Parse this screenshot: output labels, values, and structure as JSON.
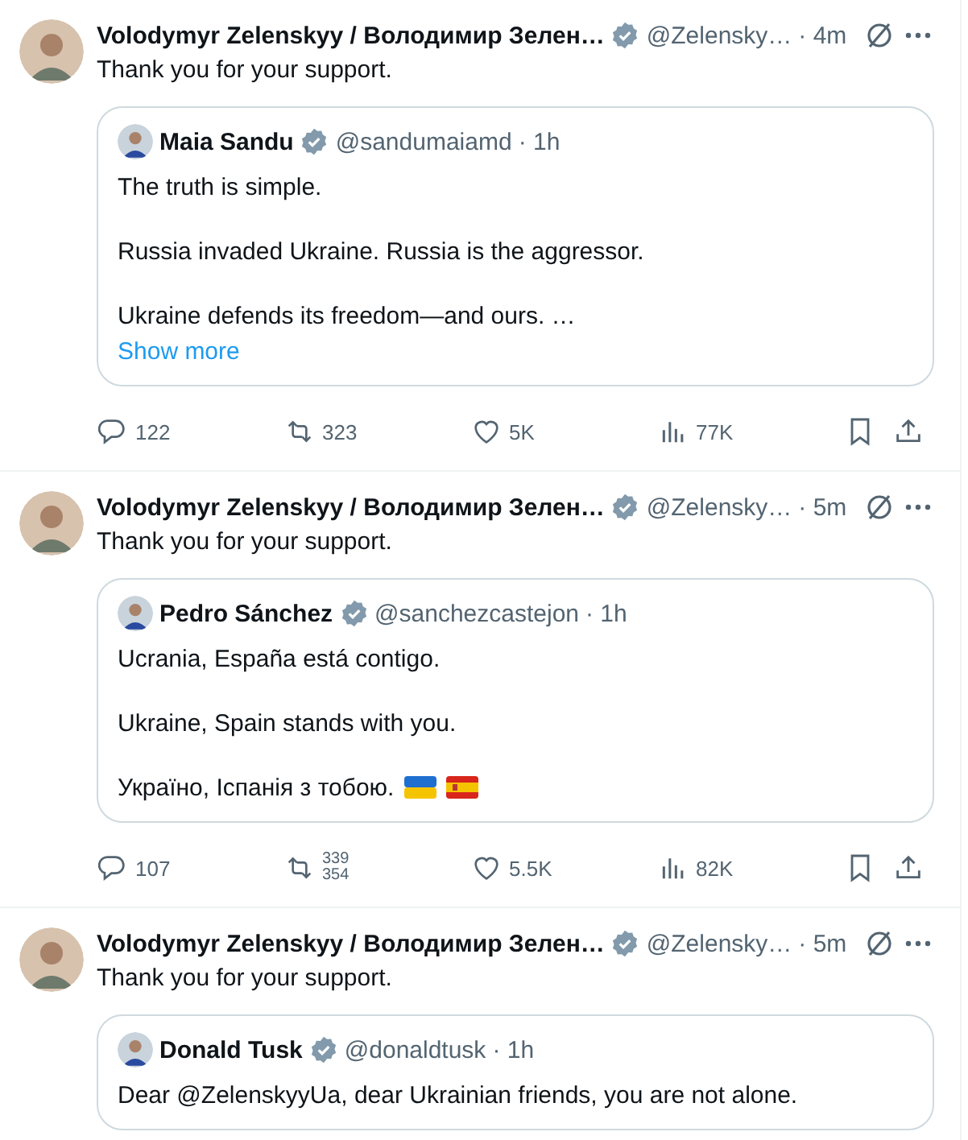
{
  "posts": [
    {
      "author": "Volodymyr Zelenskyy / Володимир Зелен…",
      "handle": "@Zelensky…",
      "time": "· 4m",
      "text": "Thank you for your support.",
      "quote": {
        "author": "Maia Sandu",
        "handle": "@sandumaiamd",
        "time": "· 1h",
        "paragraphs": [
          "The truth is simple.",
          "Russia invaded Ukraine. Russia is the aggressor.",
          "Ukraine defends its freedom—and ours. …"
        ],
        "show_more": "Show more"
      },
      "stats": [
        {
          "kind": "reply",
          "counts": [
            "122"
          ]
        },
        {
          "kind": "repost",
          "counts": [
            "323"
          ]
        },
        {
          "kind": "like",
          "counts": [
            "5K"
          ]
        },
        {
          "kind": "views",
          "counts": [
            "77K"
          ]
        },
        {
          "kind": "bookmark"
        },
        {
          "kind": "share"
        }
      ]
    },
    {
      "author": "Volodymyr Zelenskyy / Володимир Зелен…",
      "handle": "@Zelensky…",
      "time": "· 5m",
      "text": "Thank you for your support.",
      "quote": {
        "author": "Pedro Sánchez",
        "handle": "@sanchezcastejon",
        "time": "· 1h",
        "paragraphs": [
          "Ucrania, España está contigo.",
          "Ukraine, Spain stands with you.",
          "Україно, Іспанія з тобою."
        ],
        "trailing_icons": [
          {
            "kind": "flag-ua"
          },
          {
            "kind": "flag-es"
          }
        ]
      },
      "stats": [
        {
          "kind": "reply",
          "counts": [
            "107"
          ]
        },
        {
          "kind": "repost",
          "counts": [
            "339",
            "354"
          ]
        },
        {
          "kind": "like",
          "counts": [
            "5.5K"
          ]
        },
        {
          "kind": "views",
          "counts": [
            "82K"
          ]
        },
        {
          "kind": "bookmark"
        },
        {
          "kind": "share"
        }
      ]
    },
    {
      "author": "Volodymyr Zelenskyy / Володимир Зелен…",
      "handle": "@Zelensky…",
      "time": "· 5m",
      "text": "Thank you for your support.",
      "quote": {
        "author": "Donald Tusk",
        "handle": "@donaldtusk",
        "time": "· 1h",
        "paragraphs": [
          "Dear @ZelenskyyUa, dear Ukrainian friends, you are not alone."
        ]
      }
    }
  ]
}
